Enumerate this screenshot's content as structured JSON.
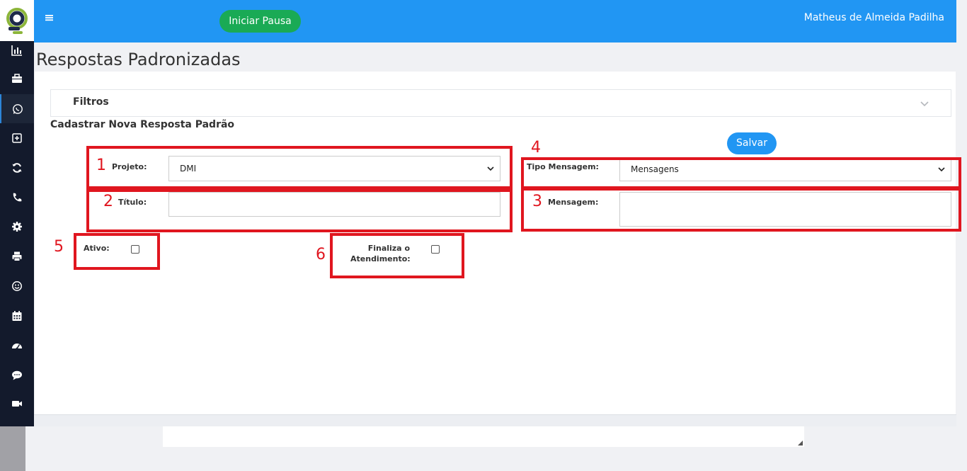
{
  "header": {
    "pause_button": "Iniciar Pausa",
    "user_name": "Matheus de Almeida Padilha"
  },
  "page": {
    "title": "Respostas Padronizadas"
  },
  "filters": {
    "label": "Filtros"
  },
  "form": {
    "title": "Cadastrar Nova Resposta Padrão",
    "save_button": "Salvar",
    "projeto": {
      "label": "Projeto:",
      "value": "DMI"
    },
    "titulo": {
      "label": "Título:",
      "value": ""
    },
    "tipo_mensagem": {
      "label": "Tipo Mensagem:",
      "value": "Mensagens"
    },
    "mensagem": {
      "label": "Mensagem:",
      "value": ""
    },
    "ativo": {
      "label": "Ativo:",
      "checked": false
    },
    "finaliza": {
      "label_line1": "Finaliza o",
      "label_line2": "Atendimento:",
      "checked": false
    }
  },
  "annotations": [
    "1",
    "2",
    "3",
    "4",
    "5",
    "6"
  ],
  "sidebar": {
    "items": [
      {
        "icon": "bar-chart-icon"
      },
      {
        "icon": "briefcase-icon"
      },
      {
        "icon": "whatsapp-icon",
        "active": true
      },
      {
        "icon": "plus-square-icon"
      },
      {
        "icon": "refresh-icon"
      },
      {
        "icon": "phone-icon"
      },
      {
        "icon": "gear-icon"
      },
      {
        "icon": "printer-icon"
      },
      {
        "icon": "smile-icon"
      },
      {
        "icon": "calendar-icon"
      },
      {
        "icon": "dashboard-icon"
      },
      {
        "icon": "chat-icon"
      },
      {
        "icon": "video-icon"
      }
    ]
  },
  "colors": {
    "topbar": "#2196f3",
    "sidebar": "#131a2c",
    "pause_button": "#1aaa55",
    "save_button": "#2196f3",
    "annotation": "#e0161f"
  }
}
